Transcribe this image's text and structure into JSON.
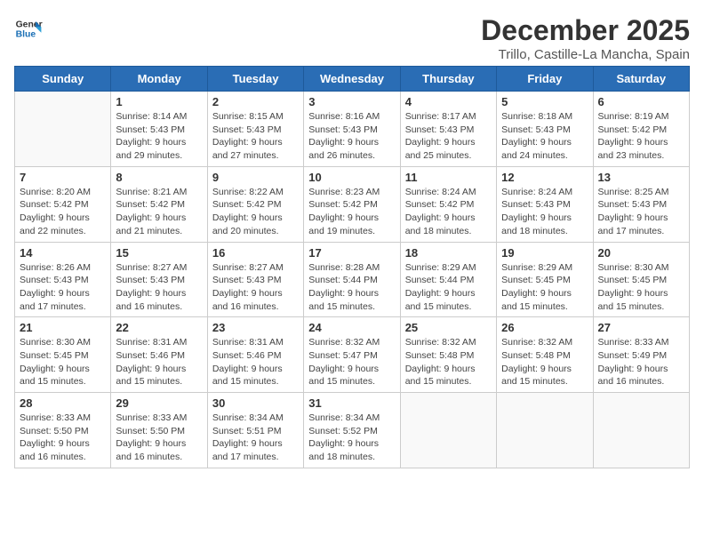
{
  "logo": {
    "line1": "General",
    "line2": "Blue"
  },
  "title": "December 2025",
  "subtitle": "Trillo, Castille-La Mancha, Spain",
  "days_of_week": [
    "Sunday",
    "Monday",
    "Tuesday",
    "Wednesday",
    "Thursday",
    "Friday",
    "Saturday"
  ],
  "weeks": [
    [
      {
        "day": "",
        "sunrise": "",
        "sunset": "",
        "daylight": ""
      },
      {
        "day": "1",
        "sunrise": "Sunrise: 8:14 AM",
        "sunset": "Sunset: 5:43 PM",
        "daylight": "Daylight: 9 hours and 29 minutes."
      },
      {
        "day": "2",
        "sunrise": "Sunrise: 8:15 AM",
        "sunset": "Sunset: 5:43 PM",
        "daylight": "Daylight: 9 hours and 27 minutes."
      },
      {
        "day": "3",
        "sunrise": "Sunrise: 8:16 AM",
        "sunset": "Sunset: 5:43 PM",
        "daylight": "Daylight: 9 hours and 26 minutes."
      },
      {
        "day": "4",
        "sunrise": "Sunrise: 8:17 AM",
        "sunset": "Sunset: 5:43 PM",
        "daylight": "Daylight: 9 hours and 25 minutes."
      },
      {
        "day": "5",
        "sunrise": "Sunrise: 8:18 AM",
        "sunset": "Sunset: 5:43 PM",
        "daylight": "Daylight: 9 hours and 24 minutes."
      },
      {
        "day": "6",
        "sunrise": "Sunrise: 8:19 AM",
        "sunset": "Sunset: 5:42 PM",
        "daylight": "Daylight: 9 hours and 23 minutes."
      }
    ],
    [
      {
        "day": "7",
        "sunrise": "Sunrise: 8:20 AM",
        "sunset": "Sunset: 5:42 PM",
        "daylight": "Daylight: 9 hours and 22 minutes."
      },
      {
        "day": "8",
        "sunrise": "Sunrise: 8:21 AM",
        "sunset": "Sunset: 5:42 PM",
        "daylight": "Daylight: 9 hours and 21 minutes."
      },
      {
        "day": "9",
        "sunrise": "Sunrise: 8:22 AM",
        "sunset": "Sunset: 5:42 PM",
        "daylight": "Daylight: 9 hours and 20 minutes."
      },
      {
        "day": "10",
        "sunrise": "Sunrise: 8:23 AM",
        "sunset": "Sunset: 5:42 PM",
        "daylight": "Daylight: 9 hours and 19 minutes."
      },
      {
        "day": "11",
        "sunrise": "Sunrise: 8:24 AM",
        "sunset": "Sunset: 5:42 PM",
        "daylight": "Daylight: 9 hours and 18 minutes."
      },
      {
        "day": "12",
        "sunrise": "Sunrise: 8:24 AM",
        "sunset": "Sunset: 5:43 PM",
        "daylight": "Daylight: 9 hours and 18 minutes."
      },
      {
        "day": "13",
        "sunrise": "Sunrise: 8:25 AM",
        "sunset": "Sunset: 5:43 PM",
        "daylight": "Daylight: 9 hours and 17 minutes."
      }
    ],
    [
      {
        "day": "14",
        "sunrise": "Sunrise: 8:26 AM",
        "sunset": "Sunset: 5:43 PM",
        "daylight": "Daylight: 9 hours and 17 minutes."
      },
      {
        "day": "15",
        "sunrise": "Sunrise: 8:27 AM",
        "sunset": "Sunset: 5:43 PM",
        "daylight": "Daylight: 9 hours and 16 minutes."
      },
      {
        "day": "16",
        "sunrise": "Sunrise: 8:27 AM",
        "sunset": "Sunset: 5:43 PM",
        "daylight": "Daylight: 9 hours and 16 minutes."
      },
      {
        "day": "17",
        "sunrise": "Sunrise: 8:28 AM",
        "sunset": "Sunset: 5:44 PM",
        "daylight": "Daylight: 9 hours and 15 minutes."
      },
      {
        "day": "18",
        "sunrise": "Sunrise: 8:29 AM",
        "sunset": "Sunset: 5:44 PM",
        "daylight": "Daylight: 9 hours and 15 minutes."
      },
      {
        "day": "19",
        "sunrise": "Sunrise: 8:29 AM",
        "sunset": "Sunset: 5:45 PM",
        "daylight": "Daylight: 9 hours and 15 minutes."
      },
      {
        "day": "20",
        "sunrise": "Sunrise: 8:30 AM",
        "sunset": "Sunset: 5:45 PM",
        "daylight": "Daylight: 9 hours and 15 minutes."
      }
    ],
    [
      {
        "day": "21",
        "sunrise": "Sunrise: 8:30 AM",
        "sunset": "Sunset: 5:45 PM",
        "daylight": "Daylight: 9 hours and 15 minutes."
      },
      {
        "day": "22",
        "sunrise": "Sunrise: 8:31 AM",
        "sunset": "Sunset: 5:46 PM",
        "daylight": "Daylight: 9 hours and 15 minutes."
      },
      {
        "day": "23",
        "sunrise": "Sunrise: 8:31 AM",
        "sunset": "Sunset: 5:46 PM",
        "daylight": "Daylight: 9 hours and 15 minutes."
      },
      {
        "day": "24",
        "sunrise": "Sunrise: 8:32 AM",
        "sunset": "Sunset: 5:47 PM",
        "daylight": "Daylight: 9 hours and 15 minutes."
      },
      {
        "day": "25",
        "sunrise": "Sunrise: 8:32 AM",
        "sunset": "Sunset: 5:48 PM",
        "daylight": "Daylight: 9 hours and 15 minutes."
      },
      {
        "day": "26",
        "sunrise": "Sunrise: 8:32 AM",
        "sunset": "Sunset: 5:48 PM",
        "daylight": "Daylight: 9 hours and 15 minutes."
      },
      {
        "day": "27",
        "sunrise": "Sunrise: 8:33 AM",
        "sunset": "Sunset: 5:49 PM",
        "daylight": "Daylight: 9 hours and 16 minutes."
      }
    ],
    [
      {
        "day": "28",
        "sunrise": "Sunrise: 8:33 AM",
        "sunset": "Sunset: 5:50 PM",
        "daylight": "Daylight: 9 hours and 16 minutes."
      },
      {
        "day": "29",
        "sunrise": "Sunrise: 8:33 AM",
        "sunset": "Sunset: 5:50 PM",
        "daylight": "Daylight: 9 hours and 16 minutes."
      },
      {
        "day": "30",
        "sunrise": "Sunrise: 8:34 AM",
        "sunset": "Sunset: 5:51 PM",
        "daylight": "Daylight: 9 hours and 17 minutes."
      },
      {
        "day": "31",
        "sunrise": "Sunrise: 8:34 AM",
        "sunset": "Sunset: 5:52 PM",
        "daylight": "Daylight: 9 hours and 18 minutes."
      },
      {
        "day": "",
        "sunrise": "",
        "sunset": "",
        "daylight": ""
      },
      {
        "day": "",
        "sunrise": "",
        "sunset": "",
        "daylight": ""
      },
      {
        "day": "",
        "sunrise": "",
        "sunset": "",
        "daylight": ""
      }
    ]
  ]
}
